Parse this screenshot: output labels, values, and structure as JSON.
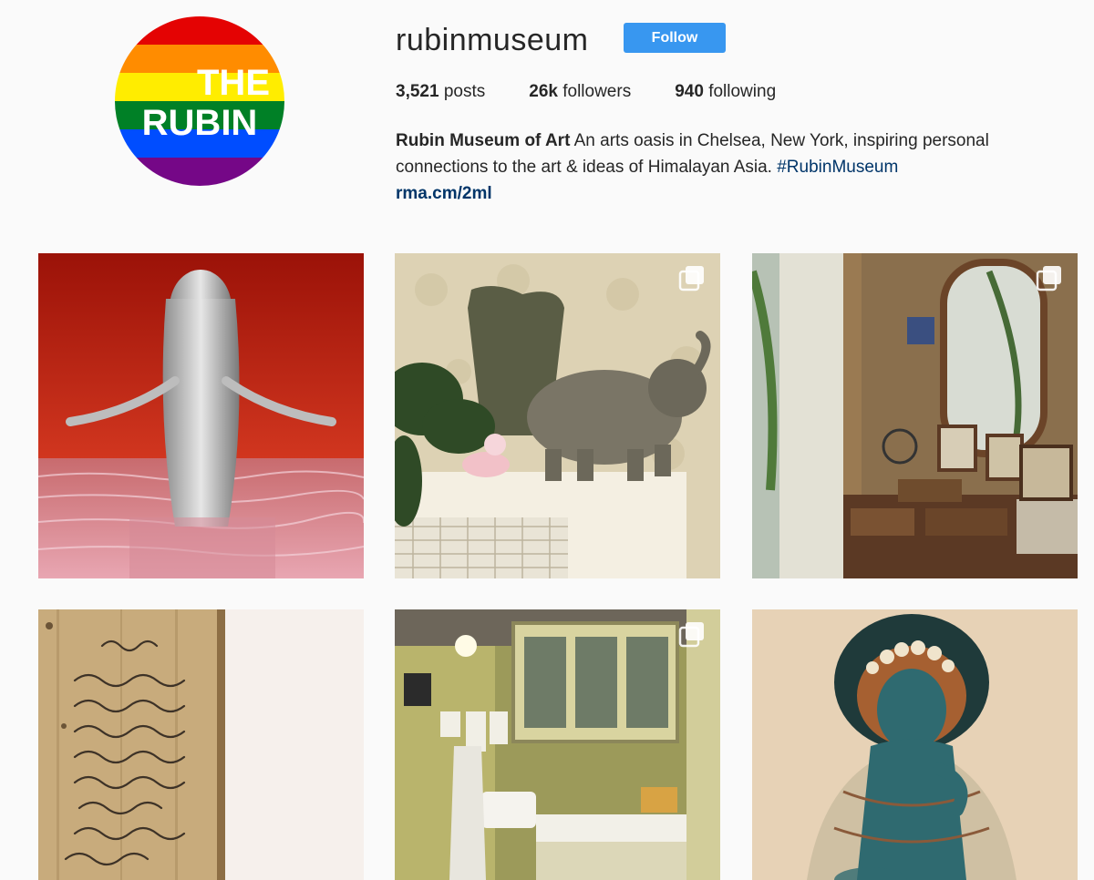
{
  "profile": {
    "username": "rubinmuseum",
    "follow_label": "Follow",
    "avatar_line1": "THE",
    "avatar_line2": "RUBIN",
    "stats": [
      {
        "value": "3,521",
        "label": "posts"
      },
      {
        "value": "26k",
        "label": "followers"
      },
      {
        "value": "940",
        "label": "following"
      }
    ],
    "bio": {
      "name": "Rubin Museum of Art",
      "text": " An arts oasis in Chelsea, New York, inspiring personal connections to the art & ideas of Himalayan Asia. ",
      "hashtag": "#RubinMuseum",
      "link": "rma.cm/2ml"
    }
  },
  "colors": {
    "follow_button": "#3897f0",
    "link": "#003569",
    "background": "#fafafa"
  },
  "posts": [
    {
      "subject": "silver figure standing in water on red background",
      "multi": false
    },
    {
      "subject": "brass elephant and vase on radiator shelf",
      "multi": true
    },
    {
      "subject": "vintage dresser with mirror and framed photos",
      "multi": true
    },
    {
      "subject": "wooden board with handwritten tallies",
      "multi": false
    },
    {
      "subject": "old kitchen with cabinets and sink",
      "multi": true
    },
    {
      "subject": "Himalayan painting of blue deity",
      "multi": false
    }
  ]
}
